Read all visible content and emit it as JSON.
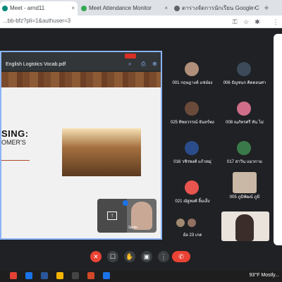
{
  "browser": {
    "tabs": [
      {
        "title": "Meet - arnd11",
        "close": "×"
      },
      {
        "title": "Meet Attendance Monitor",
        "close": "×"
      },
      {
        "title": "ตารางจัดการนักเรียน Google Classroo",
        "close": "×"
      }
    ],
    "new_tab": "+",
    "url": "...bb-bfz?pli=1&authuser=3"
  },
  "presentation": {
    "file_name": "English Logistics Vocab.pdf",
    "slide_title": "SING:",
    "slide_subtitle": "OMER'S"
  },
  "self_view": {
    "name": "Sprite"
  },
  "participants": [
    {
      "name": "001 กฤษฎางค์ แซ่อ๋อง"
    },
    {
      "name": "006 ธัญชนก คิดดอนศา"
    },
    {
      "name": "025 ทิพยวรรณ์ จันทร์พงษ์"
    },
    {
      "name": "008 ณภัทรศรี ทัน ไม่"
    },
    {
      "name": "016 วชิรพงศ์ แก้วหมุ่"
    },
    {
      "name": "017 สาวิน แมวกาม"
    },
    {
      "name": "021 ณัฐพงศ์ ลิ้มเส็ง"
    },
    {
      "name": "005 ภูมิพัฒน์ ภูมิ"
    },
    {
      "name": "อ้อ 23 เกด"
    }
  ],
  "controls": {
    "mic": "✕",
    "captions": "☐",
    "raise_hand": "✋",
    "present": "▣",
    "more": "⋮",
    "end_call": "✆"
  },
  "taskbar": {
    "weather": "93°F Mostly..."
  },
  "colors": {
    "meet_bg": "#202124",
    "accent_border": "#8ab4f8",
    "end_call_red": "#ea4335"
  }
}
